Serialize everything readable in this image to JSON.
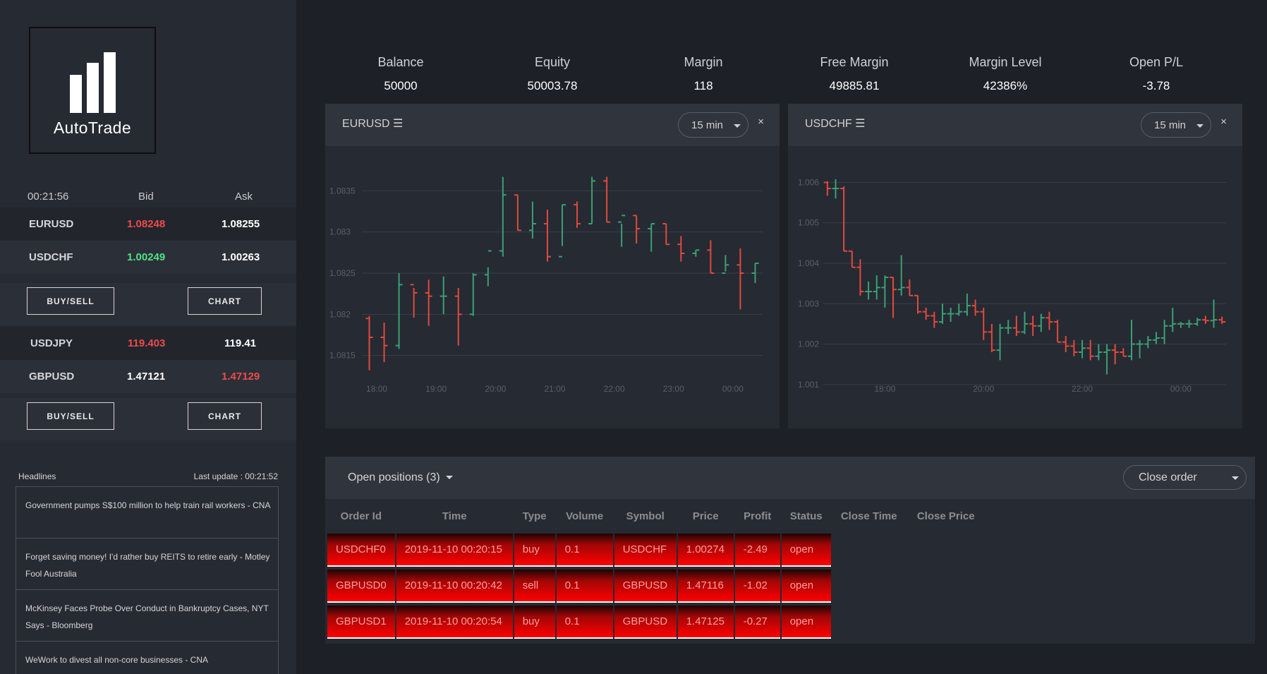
{
  "app": {
    "name": "AutoTrade"
  },
  "quotes": {
    "time": "00:21:56",
    "bid_label": "Bid",
    "ask_label": "Ask",
    "rows": [
      {
        "symbol": "EURUSD",
        "bid": "1.08248",
        "ask": "1.08255",
        "bid_color": "#ee4b4b",
        "ask_color": "#ffffff"
      },
      {
        "symbol": "USDCHF",
        "bid": "1.00249",
        "ask": "1.00263",
        "bid_color": "#4ee286",
        "ask_color": "#ffffff"
      },
      {
        "symbol": "USDJPY",
        "bid": "119.403",
        "ask": "119.41",
        "bid_color": "#ee4b4b",
        "ask_color": "#ffffff"
      },
      {
        "symbol": "GBPUSD",
        "bid": "1.47121",
        "ask": "1.47129",
        "bid_color": "#ffffff",
        "ask_color": "#ee4b4b"
      }
    ],
    "buysell_label": "BUY/SELL",
    "chart_label": "CHART"
  },
  "news": {
    "title": "Headlines",
    "last_update": "Last update : 00:21:52",
    "items": [
      "Government pumps S$100 million to help train rail workers - CNA",
      "Forget saving money! I'd rather buy REITS to retire early - Motley Fool Australia",
      "McKinsey Faces Probe Over Conduct in Bankruptcy Cases, NYT Says - Bloomberg",
      "WeWork to divest all non-core businesses - CNA"
    ]
  },
  "account": {
    "stats": [
      {
        "label": "Balance",
        "value": "50000"
      },
      {
        "label": "Equity",
        "value": "50003.78"
      },
      {
        "label": "Margin",
        "value": "118"
      },
      {
        "label": "Free Margin",
        "value": "49885.81"
      },
      {
        "label": "Margin Level",
        "value": "42386%"
      },
      {
        "label": "Open P/L",
        "value": "-3.78"
      }
    ]
  },
  "charts": [
    {
      "symbol": "EURUSD ☰",
      "timeframe": "15 min",
      "close": "×"
    },
    {
      "symbol": "USDCHF ☰",
      "timeframe": "15 min",
      "close": "×"
    }
  ],
  "chart_data": [
    {
      "type": "ohlc",
      "symbol": "EURUSD",
      "x_ticks": [
        "18:00",
        "19:00",
        "20:00",
        "21:00",
        "22:00",
        "23:00",
        "00:00"
      ],
      "y_ticks": [
        "1.0835",
        "1.083",
        "1.0825",
        "1.082",
        "1.0815"
      ],
      "y_tick_values": [
        1.0835,
        1.083,
        1.0825,
        1.082,
        1.0815
      ],
      "ylim": [
        1.0813,
        1.0837
      ],
      "up_color": "#3aa076",
      "down_color": "#e04a3e",
      "x_start": "17:45",
      "interval_min": 15,
      "ohlc": [
        [
          1.08195,
          1.08198,
          1.08132,
          1.08172
        ],
        [
          1.08172,
          1.0819,
          1.08142,
          1.08162
        ],
        [
          1.08162,
          1.0825,
          1.08158,
          1.08236
        ],
        [
          1.08236,
          1.08232,
          1.08196,
          1.08226
        ],
        [
          1.08226,
          1.08242,
          1.08186,
          1.08222
        ],
        [
          1.08222,
          1.08246,
          1.082,
          1.08222
        ],
        [
          1.08222,
          1.08232,
          1.08162,
          1.082
        ],
        [
          1.082,
          1.0825,
          1.08198,
          1.08248
        ],
        [
          1.08248,
          1.08257,
          1.08234,
          1.08277
        ],
        [
          1.08277,
          1.08367,
          1.0827,
          1.08345
        ],
        [
          1.08345,
          1.08345,
          1.08302,
          1.08302
        ],
        [
          1.08302,
          1.08337,
          1.08292,
          1.0831
        ],
        [
          1.0831,
          1.08327,
          1.08264,
          1.0827
        ],
        [
          1.0827,
          1.08333,
          1.08283,
          1.08333
        ],
        [
          1.08333,
          1.08337,
          1.08305,
          1.0831
        ],
        [
          1.0831,
          1.08367,
          1.0831,
          1.08362
        ],
        [
          1.08362,
          1.08367,
          1.08312,
          1.08312
        ],
        [
          1.08312,
          1.0831,
          1.08282,
          1.0832
        ],
        [
          1.0832,
          1.0832,
          1.08286,
          1.08304
        ],
        [
          1.08304,
          1.0831,
          1.08276,
          1.0831
        ],
        [
          1.0831,
          1.0831,
          1.08285,
          1.08285
        ],
        [
          1.08285,
          1.08295,
          1.08264,
          1.08274
        ],
        [
          1.08274,
          1.08278,
          1.0827,
          1.08278
        ],
        [
          1.08278,
          1.0829,
          1.0825,
          1.0825
        ],
        [
          1.0825,
          1.08272,
          1.08252,
          1.0826
        ],
        [
          1.0826,
          1.0828,
          1.08206,
          1.0825
        ],
        [
          1.0825,
          1.08262,
          1.08238,
          1.08262
        ]
      ]
    },
    {
      "type": "ohlc",
      "symbol": "USDCHF",
      "x_ticks": [
        "18:00",
        "20:00",
        "22:00",
        "00:00"
      ],
      "y_ticks": [
        "1.006",
        "1.005",
        "1.004",
        "1.003",
        "1.002",
        "1.001"
      ],
      "y_tick_values": [
        1.006,
        1.005,
        1.004,
        1.003,
        1.002,
        1.001
      ],
      "ylim": [
        1.0007,
        1.0062
      ],
      "up_color": "#3aa076",
      "down_color": "#e04a3e",
      "x_start": "16:45",
      "interval_min": 10,
      "ohlc": [
        [
          1.006,
          1.00603,
          1.00567,
          1.00585
        ],
        [
          1.00585,
          1.00608,
          1.0056,
          1.00585
        ],
        [
          1.00585,
          1.0059,
          1.0043,
          1.0043
        ],
        [
          1.0043,
          1.0043,
          1.0039,
          1.0039
        ],
        [
          1.0039,
          1.0041,
          1.0032,
          1.0033
        ],
        [
          1.0033,
          1.00355,
          1.0031,
          1.0033
        ],
        [
          1.0033,
          1.0037,
          1.0031,
          1.0034
        ],
        [
          1.0034,
          1.0037,
          1.0029,
          1.00365
        ],
        [
          1.00365,
          1.00365,
          1.00265,
          1.00335
        ],
        [
          1.00335,
          1.0042,
          1.0032,
          1.0034
        ],
        [
          1.0034,
          1.0036,
          1.0032,
          1.0032
        ],
        [
          1.0032,
          1.0032,
          1.00275,
          1.0028
        ],
        [
          1.0028,
          1.0029,
          1.0026,
          1.0027
        ],
        [
          1.0027,
          1.0028,
          1.0024,
          1.00255
        ],
        [
          1.00255,
          1.003,
          1.0025,
          1.00275
        ],
        [
          1.00275,
          1.0029,
          1.00255,
          1.00275
        ],
        [
          1.00275,
          1.003,
          1.0027,
          1.0028
        ],
        [
          1.0028,
          1.00325,
          1.0027,
          1.00295
        ],
        [
          1.00295,
          1.0031,
          1.0027,
          1.0028
        ],
        [
          1.0028,
          1.0029,
          1.0021,
          1.0023
        ],
        [
          1.0023,
          1.0025,
          1.0018,
          1.00185
        ],
        [
          1.00185,
          1.0025,
          1.0016,
          1.0024
        ],
        [
          1.0024,
          1.0026,
          1.00225,
          1.0024
        ],
        [
          1.0024,
          1.0027,
          1.0022,
          1.0023
        ],
        [
          1.0023,
          1.0028,
          1.00225,
          1.0025
        ],
        [
          1.0025,
          1.0027,
          1.0022,
          1.00245
        ],
        [
          1.00245,
          1.00275,
          1.0023,
          1.00265
        ],
        [
          1.00265,
          1.0028,
          1.00235,
          1.00255
        ],
        [
          1.00255,
          1.0026,
          1.00205,
          1.00205
        ],
        [
          1.00205,
          1.0022,
          1.0018,
          1.00195
        ],
        [
          1.00195,
          1.0021,
          1.0017,
          1.0018
        ],
        [
          1.0018,
          1.0021,
          1.00165,
          1.0019
        ],
        [
          1.0019,
          1.0021,
          1.0016,
          1.0017
        ],
        [
          1.0017,
          1.002,
          1.0016,
          1.0018
        ],
        [
          1.0018,
          1.002,
          1.00125,
          1.00185
        ],
        [
          1.00185,
          1.002,
          1.0015,
          1.0018
        ],
        [
          1.0018,
          1.0019,
          1.0017,
          1.0017
        ],
        [
          1.0017,
          1.0026,
          1.0016,
          1.002
        ],
        [
          1.002,
          1.0021,
          1.00165,
          1.002
        ],
        [
          1.002,
          1.0022,
          1.0019,
          1.0021
        ],
        [
          1.0021,
          1.0023,
          1.002,
          1.00215
        ],
        [
          1.00215,
          1.0026,
          1.002,
          1.00245
        ],
        [
          1.00245,
          1.0029,
          1.0023,
          1.0025
        ],
        [
          1.0025,
          1.00255,
          1.0024,
          1.0025
        ],
        [
          1.0025,
          1.0026,
          1.0024,
          1.0025
        ],
        [
          1.0025,
          1.00265,
          1.00245,
          1.0026
        ],
        [
          1.0026,
          1.0027,
          1.0025,
          1.00258
        ],
        [
          1.00258,
          1.0031,
          1.0024,
          1.0026
        ],
        [
          1.0026,
          1.00268,
          1.0025,
          1.00255
        ]
      ]
    }
  ],
  "orders": {
    "title": "Open positions (3)",
    "close_order_label": "Close order",
    "columns": [
      "Order Id",
      "Time",
      "Type",
      "Volume",
      "Symbol",
      "Price",
      "Profit",
      "Status",
      "Close Time",
      "Close Price"
    ],
    "rows": [
      [
        "USDCHF0",
        "2019-11-10 00:20:15",
        "buy",
        "0.1",
        "USDCHF",
        "1.00274",
        "-2.49",
        "open"
      ],
      [
        "GBPUSD0",
        "2019-11-10 00:20:42",
        "sell",
        "0.1",
        "GBPUSD",
        "1.47116",
        "-1.02",
        "open"
      ],
      [
        "GBPUSD1",
        "2019-11-10 00:20:54",
        "buy",
        "0.1",
        "GBPUSD",
        "1.47125",
        "-0.27",
        "open"
      ]
    ]
  }
}
